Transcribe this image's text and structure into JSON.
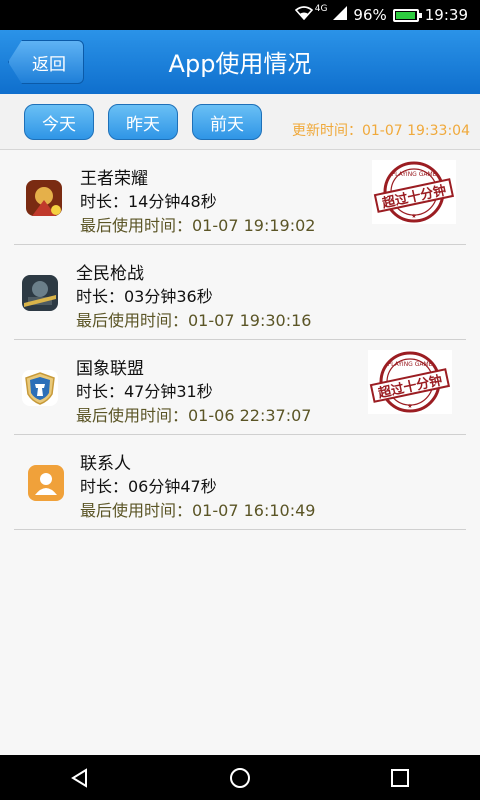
{
  "status_bar": {
    "network": "4G",
    "battery": "96%",
    "time": "19:39"
  },
  "header": {
    "back_label": "返回",
    "title": "App使用情况"
  },
  "tabs": [
    {
      "label": "今天"
    },
    {
      "label": "昨天"
    },
    {
      "label": "前天"
    }
  ],
  "update_time": "更新时间：01-07 19:33:04",
  "apps": [
    {
      "name": "王者荣耀",
      "duration": "时长：14分钟48秒",
      "last_used": "最后使用时间：01-07 19:19:02",
      "icon": "honor-of-kings-icon",
      "over_ten_minutes": true
    },
    {
      "name": "全民枪战",
      "duration": "时长：03分钟36秒",
      "last_used": "最后使用时间：01-07 19:30:16",
      "icon": "shooter-game-icon",
      "over_ten_minutes": false
    },
    {
      "name": "国象联盟",
      "duration": "时长：47分钟31秒",
      "last_used": "最后使用时间：01-06 22:37:07",
      "icon": "chess-shield-icon",
      "over_ten_minutes": true
    },
    {
      "name": "联系人",
      "duration": "时长：06分钟47秒",
      "last_used": "最后使用时间：01-07 16:10:49",
      "icon": "contacts-icon",
      "over_ten_minutes": false
    }
  ],
  "stamp": {
    "text": "超过十分钟",
    "small_text": "PLAYING GAME"
  },
  "colors": {
    "header": "#1a7fd9",
    "update_time": "#f0a93b",
    "stamp": "#9b1d22"
  }
}
